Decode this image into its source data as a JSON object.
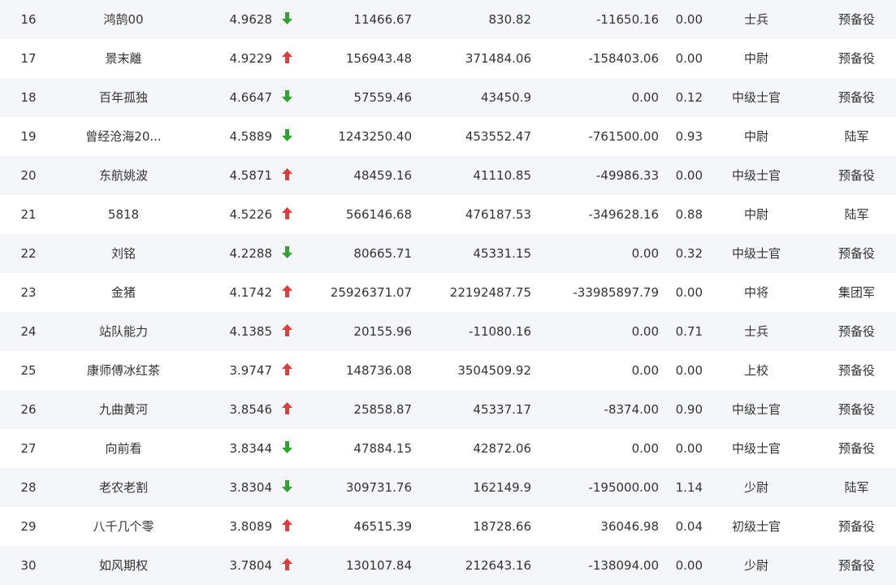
{
  "colors": {
    "up": "#e03c3c",
    "down": "#2ea52e",
    "row_even": "#f5f6f9",
    "row_odd": "#ffffff",
    "text": "#333333"
  },
  "rows": [
    {
      "rank": "16",
      "name": "鸿鹄00",
      "score": "4.9628",
      "trend": "down",
      "v1": "11466.67",
      "v2": "830.82",
      "v3": "-11650.16",
      "v4": "0.00",
      "title": "士兵",
      "corps": "预备役"
    },
    {
      "rank": "17",
      "name": "景末離",
      "score": "4.9229",
      "trend": "up",
      "v1": "156943.48",
      "v2": "371484.06",
      "v3": "-158403.06",
      "v4": "0.00",
      "title": "中尉",
      "corps": "预备役"
    },
    {
      "rank": "18",
      "name": "百年孤独",
      "score": "4.6647",
      "trend": "down",
      "v1": "57559.46",
      "v2": "43450.9",
      "v3": "0.00",
      "v4": "0.12",
      "title": "中级士官",
      "corps": "预备役"
    },
    {
      "rank": "19",
      "name": "曾经沧海20...",
      "score": "4.5889",
      "trend": "down",
      "v1": "1243250.40",
      "v2": "453552.47",
      "v3": "-761500.00",
      "v4": "0.93",
      "title": "中尉",
      "corps": "陆军"
    },
    {
      "rank": "20",
      "name": "东航姚波",
      "score": "4.5871",
      "trend": "up",
      "v1": "48459.16",
      "v2": "41110.85",
      "v3": "-49986.33",
      "v4": "0.00",
      "title": "中级士官",
      "corps": "预备役"
    },
    {
      "rank": "21",
      "name": "5818",
      "score": "4.5226",
      "trend": "up",
      "v1": "566146.68",
      "v2": "476187.53",
      "v3": "-349628.16",
      "v4": "0.88",
      "title": "中尉",
      "corps": "陆军"
    },
    {
      "rank": "22",
      "name": "刘铭",
      "score": "4.2288",
      "trend": "down",
      "v1": "80665.71",
      "v2": "45331.15",
      "v3": "0.00",
      "v4": "0.32",
      "title": "中级士官",
      "corps": "预备役"
    },
    {
      "rank": "23",
      "name": "金猪",
      "score": "4.1742",
      "trend": "up",
      "v1": "25926371.07",
      "v2": "22192487.75",
      "v3": "-33985897.79",
      "v4": "0.00",
      "title": "中将",
      "corps": "集团军"
    },
    {
      "rank": "24",
      "name": "站队能力",
      "score": "4.1385",
      "trend": "up",
      "v1": "20155.96",
      "v2": "-11080.16",
      "v3": "0.00",
      "v4": "0.71",
      "title": "士兵",
      "corps": "预备役"
    },
    {
      "rank": "25",
      "name": "康师傅冰红茶",
      "score": "3.9747",
      "trend": "up",
      "v1": "148736.08",
      "v2": "3504509.92",
      "v3": "0.00",
      "v4": "0.00",
      "title": "上校",
      "corps": "预备役"
    },
    {
      "rank": "26",
      "name": "九曲黄河",
      "score": "3.8546",
      "trend": "up",
      "v1": "25858.87",
      "v2": "45337.17",
      "v3": "-8374.00",
      "v4": "0.90",
      "title": "中级士官",
      "corps": "预备役"
    },
    {
      "rank": "27",
      "name": "向前看",
      "score": "3.8344",
      "trend": "down",
      "v1": "47884.15",
      "v2": "42872.06",
      "v3": "0.00",
      "v4": "0.00",
      "title": "中级士官",
      "corps": "预备役"
    },
    {
      "rank": "28",
      "name": "老农老割",
      "score": "3.8304",
      "trend": "down",
      "v1": "309731.76",
      "v2": "162149.9",
      "v3": "-195000.00",
      "v4": "1.14",
      "title": "少尉",
      "corps": "陆军"
    },
    {
      "rank": "29",
      "name": "八千几个零",
      "score": "3.8089",
      "trend": "up",
      "v1": "46515.39",
      "v2": "18728.66",
      "v3": "36046.98",
      "v4": "0.04",
      "title": "初级士官",
      "corps": "预备役"
    },
    {
      "rank": "30",
      "name": "如风期权",
      "score": "3.7804",
      "trend": "up",
      "v1": "130107.84",
      "v2": "212643.16",
      "v3": "-138094.00",
      "v4": "0.00",
      "title": "少尉",
      "corps": "预备役"
    }
  ]
}
